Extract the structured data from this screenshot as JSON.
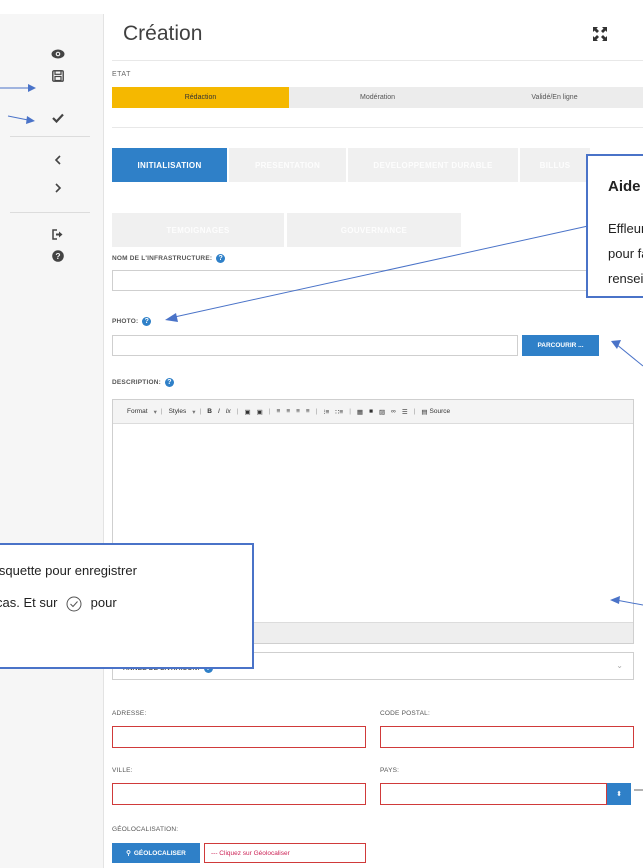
{
  "panel": {
    "title": "Création"
  },
  "sidebar": {
    "icons": [
      "eye-icon",
      "save-icon",
      "check-icon",
      "chevron-left-icon",
      "chevron-right-icon",
      "sign-out-icon",
      "help-icon"
    ]
  },
  "etat": {
    "label": "ETAT",
    "steps": [
      "Rédaction",
      "Modération",
      "Validé/En ligne"
    ],
    "active_index": 0
  },
  "tabs": [
    {
      "label": "INITIALISATION"
    },
    {
      "label": "PRESENTATION"
    },
    {
      "label": "DEVELOPPEMENT DURABLE"
    },
    {
      "label": "BILLUS"
    },
    {
      "label": "TEMOIGNAGES"
    },
    {
      "label": "GOUVERNANCE"
    }
  ],
  "fields": {
    "nom_label": "NOM DE L'INFRASTRUCTURE:",
    "photo_label": "PHOTO:",
    "browse_label": "PARCOURIR ...",
    "description_label": "DESCRIPTION:",
    "annee_label": "ANNEE DE LIVRAISON:",
    "adresse_label": "ADRESSE:",
    "code_postal_label": "CODE POSTAL:",
    "ville_label": "VILLE:",
    "pays_label": "PAYS:",
    "geoloc_label": "GÉOLOCALISATION:",
    "geoloc_button": "GÉOLOCALISER",
    "geoloc_placeholder": "--- Cliquez sur Géolocaliser"
  },
  "editor": {
    "format": "Format",
    "styles": "Styles",
    "source": "Source"
  },
  "callouts": {
    "aide_title": "Aide",
    "aide_body": "Effleure\npour fa\nrenseig",
    "save_line1": "isquette pour enregistrer",
    "save_line2a": "cas. Et sur",
    "save_line2b": "pour"
  },
  "colors": {
    "accent": "#2f80c8",
    "step_active": "#f5b800",
    "error": "#d03a3a",
    "callout_border": "#4a73c8"
  }
}
